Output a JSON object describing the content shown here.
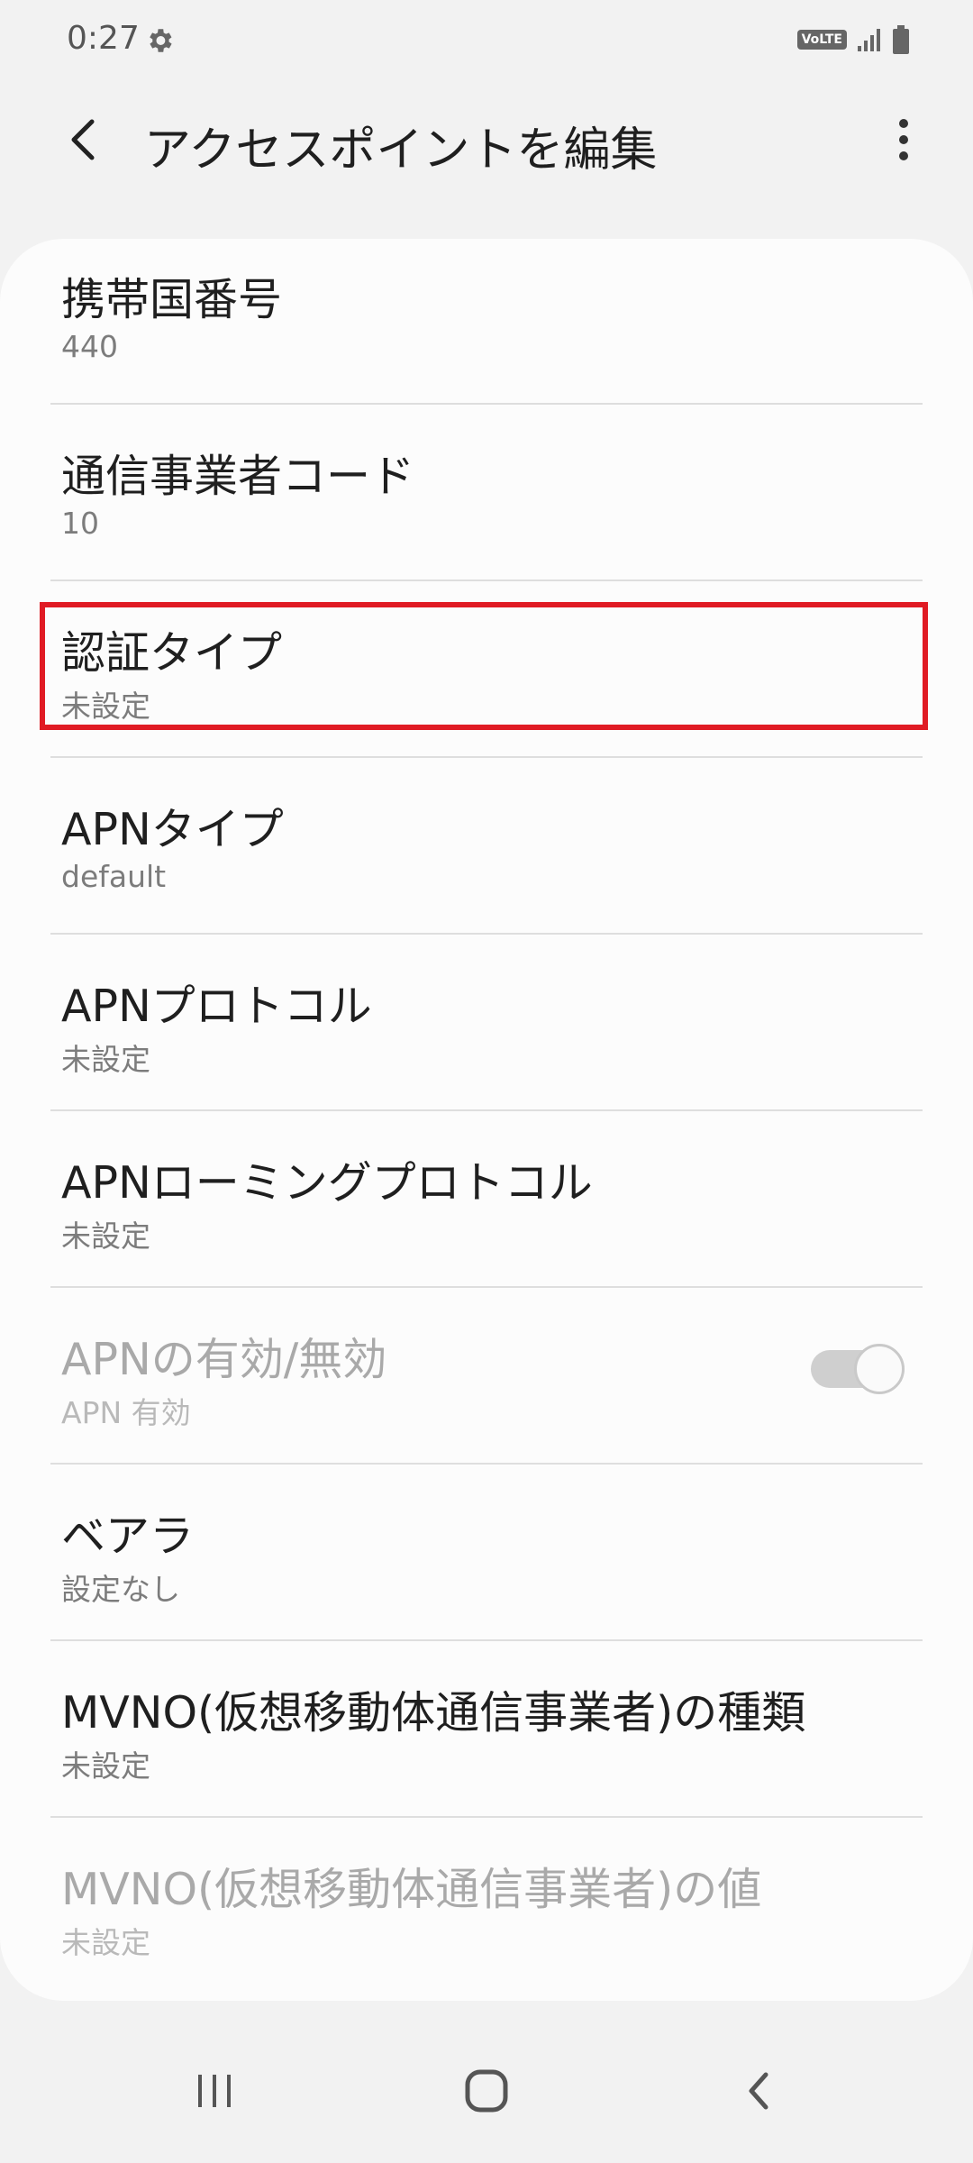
{
  "status_bar": {
    "time": "0:27",
    "volte_label": "VoLTE",
    "icons": [
      "gear-icon",
      "signal-icon",
      "battery-icon"
    ]
  },
  "app_bar": {
    "title": "アクセスポイントを編集",
    "icons": [
      "back-arrow-icon",
      "more-vert-icon"
    ]
  },
  "items": [
    {
      "title": "携帯国番号",
      "value": "440"
    },
    {
      "title": "通信事業者コード",
      "value": "10"
    },
    {
      "title": "認証タイプ",
      "value": "未設定",
      "highlighted": true
    },
    {
      "title": "APNタイプ",
      "value": "default"
    },
    {
      "title": "APNプロトコル",
      "value": "未設定"
    },
    {
      "title": "APNローミングプロトコル",
      "value": "未設定"
    },
    {
      "title": "APNの有効/無効",
      "value": "APN 有効",
      "disabled": true,
      "toggle_on": true
    },
    {
      "title": "ベアラ",
      "value": "設定なし"
    },
    {
      "title": "MVNO(仮想移動体通信事業者)の種類",
      "value": "未設定"
    },
    {
      "title": "MVNO(仮想移動体通信事業者)の値",
      "value": "未設定",
      "disabled": true
    }
  ],
  "nav_bar": {
    "icons": [
      "recent-apps-icon",
      "home-icon",
      "back-icon"
    ]
  },
  "colors": {
    "highlight": "#e01b24",
    "background": "#f2f2f2",
    "card": "#fcfcfc"
  }
}
